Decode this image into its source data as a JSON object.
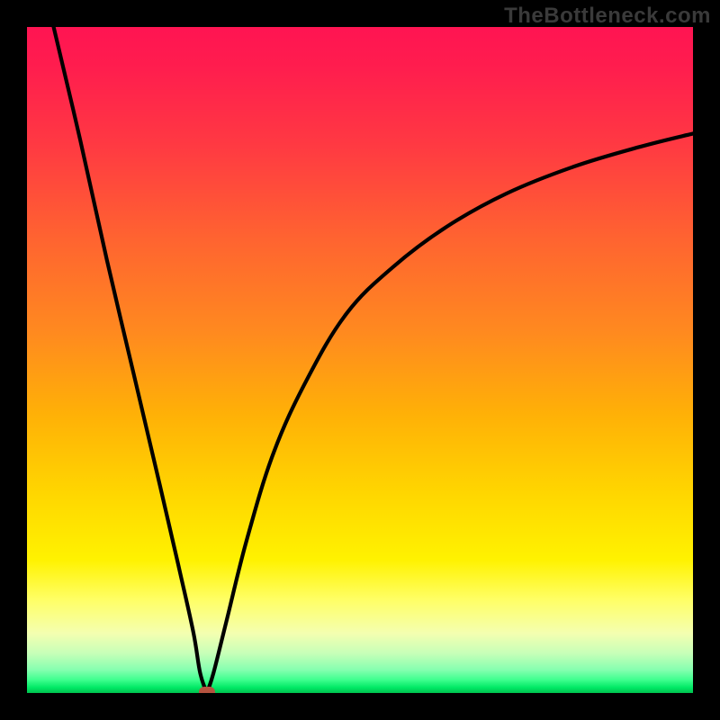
{
  "watermark": "TheBottleneck.com",
  "colors": {
    "background": "#000000",
    "curve": "#000000",
    "marker": "#b5533f"
  },
  "chart_data": {
    "type": "line",
    "title": "",
    "xlabel": "",
    "ylabel": "",
    "xlim": [
      0,
      100
    ],
    "ylim": [
      0,
      100
    ],
    "grid": false,
    "legend": false,
    "min_point": {
      "x": 27,
      "y": 0
    },
    "series": [
      {
        "name": "left-branch",
        "x": [
          4,
          8,
          12,
          16,
          20,
          23,
          25,
          26,
          27
        ],
        "y": [
          100,
          83,
          65,
          48,
          31,
          18,
          9,
          3,
          0
        ]
      },
      {
        "name": "right-branch",
        "x": [
          27,
          28,
          30,
          33,
          37,
          42,
          48,
          55,
          63,
          72,
          82,
          92,
          100
        ],
        "y": [
          0,
          3,
          11,
          23,
          36,
          47,
          57,
          64,
          70,
          75,
          79,
          82,
          84
        ]
      }
    ],
    "background_gradient_stops": [
      {
        "pos": 0.0,
        "color": "#ff1452"
      },
      {
        "pos": 0.06,
        "color": "#ff1d4e"
      },
      {
        "pos": 0.18,
        "color": "#ff3a42"
      },
      {
        "pos": 0.32,
        "color": "#ff6430"
      },
      {
        "pos": 0.46,
        "color": "#ff8a1f"
      },
      {
        "pos": 0.58,
        "color": "#ffb007"
      },
      {
        "pos": 0.7,
        "color": "#ffd600"
      },
      {
        "pos": 0.8,
        "color": "#fff200"
      },
      {
        "pos": 0.86,
        "color": "#ffff66"
      },
      {
        "pos": 0.91,
        "color": "#f4ffb0"
      },
      {
        "pos": 0.94,
        "color": "#c8ffb8"
      },
      {
        "pos": 0.965,
        "color": "#86ffb0"
      },
      {
        "pos": 0.98,
        "color": "#3fff8f"
      },
      {
        "pos": 0.992,
        "color": "#00e865"
      },
      {
        "pos": 1.0,
        "color": "#00c24e"
      }
    ]
  }
}
